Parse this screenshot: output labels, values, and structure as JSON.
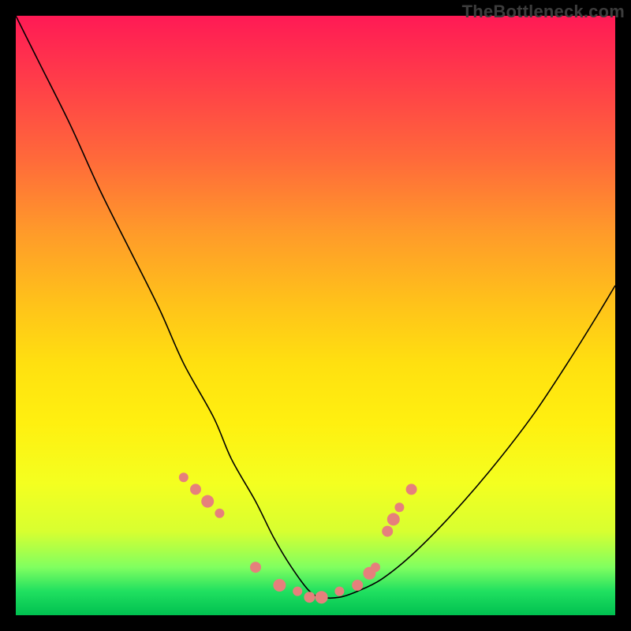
{
  "watermark": "TheBottleneck.com",
  "colors": {
    "background": "#000000",
    "line": "#000000",
    "dots": "#e6807c",
    "gradient_top": "#ff1a55",
    "gradient_bottom": "#00c050"
  },
  "chart_data": {
    "type": "line",
    "title": "",
    "xlabel": "",
    "ylabel": "",
    "xlim": [
      0,
      100
    ],
    "ylim": [
      0,
      100
    ],
    "note": "Axes are implicit (no tick labels or numeric scale shown). Values are estimated positions within the plot area on a 0–100 scale; y increases upward. The curve is a smooth V-shape with a flat trough.",
    "series": [
      {
        "name": "bottleneck-curve",
        "x": [
          0,
          4,
          9,
          14,
          19,
          24,
          28,
          33,
          36,
          40,
          43,
          46,
          49,
          51,
          54,
          57,
          61,
          66,
          72,
          79,
          86,
          92,
          97,
          100
        ],
        "y": [
          100,
          92,
          82,
          71,
          61,
          51,
          42,
          33,
          26,
          19,
          13,
          8,
          4,
          3,
          3,
          4,
          6,
          10,
          16,
          24,
          33,
          42,
          50,
          55
        ]
      }
    ],
    "scatter_points": {
      "name": "highlight-dots",
      "note": "Salmon dots clustered near the trough and lower slopes of the curve.",
      "x": [
        28,
        30,
        32,
        34,
        40,
        44,
        47,
        49,
        51,
        54,
        57,
        59,
        60,
        62,
        63,
        64,
        66
      ],
      "y": [
        23,
        21,
        19,
        17,
        8,
        5,
        4,
        3,
        3,
        4,
        5,
        7,
        8,
        14,
        16,
        18,
        21
      ]
    }
  }
}
